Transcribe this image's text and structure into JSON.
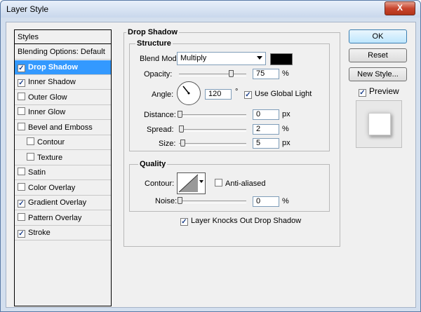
{
  "window": {
    "title": "Layer Style",
    "close_label": "X"
  },
  "styles_panel": {
    "header": "Styles",
    "items": [
      {
        "label": "Blending Options: Default",
        "checkbox": false,
        "checked": false,
        "indent": false,
        "selected": false
      },
      {
        "label": "Drop Shadow",
        "checkbox": true,
        "checked": true,
        "indent": false,
        "selected": true
      },
      {
        "label": "Inner Shadow",
        "checkbox": true,
        "checked": true,
        "indent": false,
        "selected": false
      },
      {
        "label": "Outer Glow",
        "checkbox": true,
        "checked": false,
        "indent": false,
        "selected": false
      },
      {
        "label": "Inner Glow",
        "checkbox": true,
        "checked": false,
        "indent": false,
        "selected": false
      },
      {
        "label": "Bevel and Emboss",
        "checkbox": true,
        "checked": false,
        "indent": false,
        "selected": false
      },
      {
        "label": "Contour",
        "checkbox": true,
        "checked": false,
        "indent": true,
        "selected": false
      },
      {
        "label": "Texture",
        "checkbox": true,
        "checked": false,
        "indent": true,
        "selected": false
      },
      {
        "label": "Satin",
        "checkbox": true,
        "checked": false,
        "indent": false,
        "selected": false
      },
      {
        "label": "Color Overlay",
        "checkbox": true,
        "checked": false,
        "indent": false,
        "selected": false
      },
      {
        "label": "Gradient Overlay",
        "checkbox": true,
        "checked": true,
        "indent": false,
        "selected": false
      },
      {
        "label": "Pattern Overlay",
        "checkbox": true,
        "checked": false,
        "indent": false,
        "selected": false
      },
      {
        "label": "Stroke",
        "checkbox": true,
        "checked": true,
        "indent": false,
        "selected": false
      }
    ]
  },
  "drop_shadow": {
    "title": "Drop Shadow",
    "structure": {
      "title": "Structure",
      "blend_mode_label": "Blend Mode:",
      "blend_mode_value": "Multiply",
      "blend_color": "#000000",
      "opacity_label": "Opacity:",
      "opacity_value": "75",
      "opacity_unit": "%",
      "opacity_fraction": 0.75,
      "angle_label": "Angle:",
      "angle_value": "120",
      "angle_unit": "°",
      "use_global_light_label": "Use Global Light",
      "use_global_light_checked": true,
      "distance_label": "Distance:",
      "distance_value": "0",
      "distance_unit": "px",
      "spread_label": "Spread:",
      "spread_value": "2",
      "spread_unit": "%",
      "size_label": "Size:",
      "size_value": "5",
      "size_unit": "px"
    },
    "quality": {
      "title": "Quality",
      "contour_label": "Contour:",
      "anti_aliased_label": "Anti-aliased",
      "anti_aliased_checked": false,
      "noise_label": "Noise:",
      "noise_value": "0",
      "noise_unit": "%"
    },
    "knockout_label": "Layer Knocks Out Drop Shadow",
    "knockout_checked": true
  },
  "buttons": {
    "ok": "OK",
    "reset": "Reset",
    "new_style": "New Style...",
    "preview_label": "Preview",
    "preview_checked": true
  }
}
